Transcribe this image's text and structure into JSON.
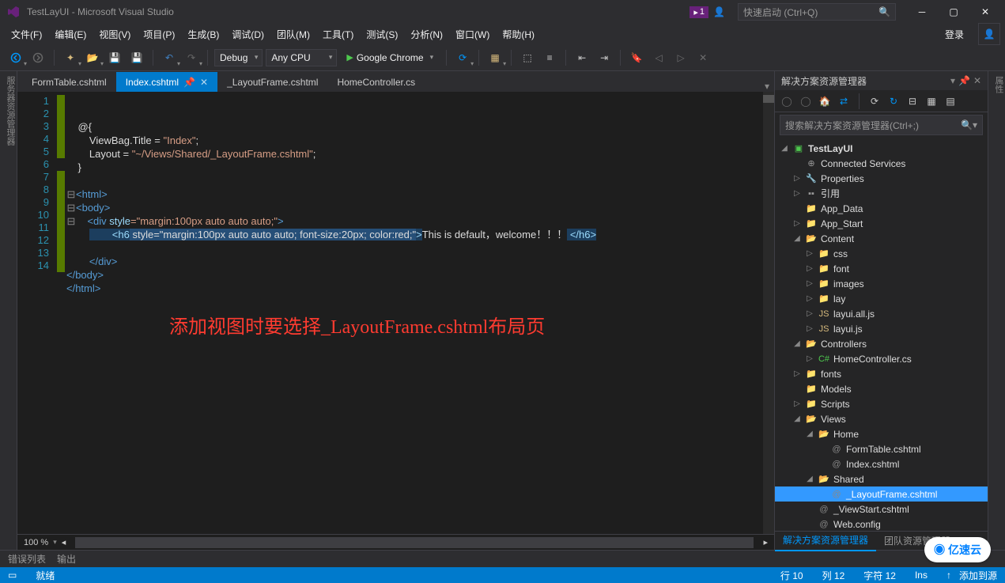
{
  "title": "TestLayUI - Microsoft Visual Studio",
  "flag_count": "1",
  "quicklaunch_placeholder": "快速启动 (Ctrl+Q)",
  "login_label": "登录",
  "menu": [
    "文件(F)",
    "编辑(E)",
    "视图(V)",
    "项目(P)",
    "生成(B)",
    "调试(D)",
    "团队(M)",
    "工具(T)",
    "测试(S)",
    "分析(N)",
    "窗口(W)",
    "帮助(H)"
  ],
  "config_dropdown": "Debug",
  "platform_dropdown": "Any CPU",
  "run_target": "Google Chrome",
  "tabs": [
    {
      "label": "FormTable.cshtml",
      "active": false
    },
    {
      "label": "Index.cshtml",
      "active": true
    },
    {
      "label": "_LayoutFrame.cshtml",
      "active": false
    },
    {
      "label": "HomeController.cs",
      "active": false
    }
  ],
  "code_lines": [
    "1",
    "2",
    "3",
    "4",
    "5",
    "6",
    "7",
    "8",
    "9",
    "10",
    "11",
    "12",
    "13",
    "14"
  ],
  "code": {
    "l2": "@{",
    "l3a": "    ViewBag.Title = ",
    "l3b": "\"Index\"",
    "l3c": ";",
    "l4a": "    Layout = ",
    "l4b": "\"~/Views/Shared/_LayoutFrame.cshtml\"",
    "l4c": ";",
    "l5": "}",
    "l7": "<html>",
    "l8": "<body>",
    "l9a": "    <div ",
    "l9b": "style",
    "l9c": "=\"margin:100px auto auto auto;\"",
    "l9d": ">",
    "l10a": "        <h6",
    "l10b": " style=\"margin:100px auto auto auto; font-size:20px; color:red;\"",
    "l10c": ">",
    "l10d": "This is default，welcome！！！",
    "l10e": " </h6>",
    "l12": "    </div>",
    "l13": "</body>",
    "l14": "</html>"
  },
  "overlay_annotation": "添加视图时要选择_LayoutFrame.cshtml布局页",
  "zoom": "100 %",
  "solution": {
    "panel_title": "解决方案资源管理器",
    "search_placeholder": "搜索解决方案资源管理器(Ctrl+;)",
    "tree": [
      {
        "d": 0,
        "arr": "open",
        "ico": "proj",
        "label": "TestLayUI",
        "bold": true
      },
      {
        "d": 1,
        "arr": "none",
        "ico": "conn",
        "label": "Connected Services"
      },
      {
        "d": 1,
        "arr": "closed",
        "ico": "prop",
        "label": "Properties"
      },
      {
        "d": 1,
        "arr": "closed",
        "ico": "ref",
        "label": "引用"
      },
      {
        "d": 1,
        "arr": "none",
        "ico": "folder",
        "label": "App_Data"
      },
      {
        "d": 1,
        "arr": "closed",
        "ico": "folder",
        "label": "App_Start"
      },
      {
        "d": 1,
        "arr": "open",
        "ico": "folder-open",
        "label": "Content"
      },
      {
        "d": 2,
        "arr": "closed",
        "ico": "folder",
        "label": "css"
      },
      {
        "d": 2,
        "arr": "closed",
        "ico": "folder",
        "label": "font"
      },
      {
        "d": 2,
        "arr": "closed",
        "ico": "folder",
        "label": "images"
      },
      {
        "d": 2,
        "arr": "closed",
        "ico": "folder",
        "label": "lay"
      },
      {
        "d": 2,
        "arr": "closed",
        "ico": "js",
        "label": "layui.all.js"
      },
      {
        "d": 2,
        "arr": "closed",
        "ico": "js",
        "label": "layui.js"
      },
      {
        "d": 1,
        "arr": "open",
        "ico": "folder-open",
        "label": "Controllers"
      },
      {
        "d": 2,
        "arr": "closed",
        "ico": "cs",
        "label": "HomeController.cs"
      },
      {
        "d": 1,
        "arr": "closed",
        "ico": "folder",
        "label": "fonts"
      },
      {
        "d": 1,
        "arr": "none",
        "ico": "folder",
        "label": "Models"
      },
      {
        "d": 1,
        "arr": "closed",
        "ico": "folder",
        "label": "Scripts"
      },
      {
        "d": 1,
        "arr": "open",
        "ico": "folder-open",
        "label": "Views"
      },
      {
        "d": 2,
        "arr": "open",
        "ico": "folder-open",
        "label": "Home"
      },
      {
        "d": 3,
        "arr": "none",
        "ico": "cshtml",
        "label": "FormTable.cshtml"
      },
      {
        "d": 3,
        "arr": "none",
        "ico": "cshtml",
        "label": "Index.cshtml"
      },
      {
        "d": 2,
        "arr": "open",
        "ico": "folder-open",
        "label": "Shared"
      },
      {
        "d": 3,
        "arr": "none",
        "ico": "cshtml",
        "label": "_LayoutFrame.cshtml",
        "sel": true
      },
      {
        "d": 2,
        "arr": "none",
        "ico": "cshtml",
        "label": "_ViewStart.cshtml"
      },
      {
        "d": 2,
        "arr": "none",
        "ico": "cshtml",
        "label": "Web.config"
      }
    ],
    "tabs": [
      "解决方案资源管理器",
      "团队资源管理器"
    ]
  },
  "bottom_tabs": [
    "错误列表",
    "输出"
  ],
  "status": {
    "ready": "就绪",
    "line": "行 10",
    "col": "列 12",
    "char": "字符 12",
    "ins": "Ins",
    "publish": "添加到源"
  },
  "watermark": "亿速云"
}
